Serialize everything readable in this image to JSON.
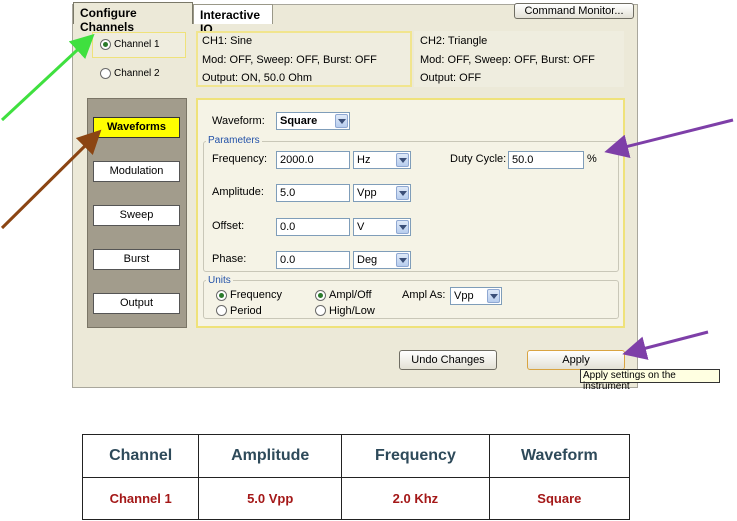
{
  "tabs": [
    "Configure Channels",
    "Interactive IO"
  ],
  "command_monitor": "Command Monitor...",
  "channels": [
    {
      "label": "Channel 1",
      "selected": true
    },
    {
      "label": "Channel 2",
      "selected": false
    }
  ],
  "ch1_info": {
    "title": "CH1:   Sine",
    "mod": "Mod: OFF, Sweep: OFF, Burst: OFF",
    "output": "Output:   ON, 50.0 Ohm"
  },
  "ch2_info": {
    "title": "CH2:   Triangle",
    "mod": "Mod: OFF, Sweep: OFF, Burst: OFF",
    "output": "Output:    OFF"
  },
  "side_menu": [
    "Waveforms",
    "Modulation",
    "Sweep",
    "Burst",
    "Output"
  ],
  "waveform": {
    "label": "Waveform:",
    "value": "Square"
  },
  "parameters": {
    "title": "Parameters",
    "frequency": {
      "label": "Frequency:",
      "value": "2000.0",
      "unit": "Hz"
    },
    "amplitude": {
      "label": "Amplitude:",
      "value": "5.0",
      "unit": "Vpp"
    },
    "offset": {
      "label": "Offset:",
      "value": "0.0",
      "unit": "V"
    },
    "phase": {
      "label": "Phase:",
      "value": "0.0",
      "unit": "Deg"
    },
    "duty_cycle": {
      "label": "Duty Cycle:",
      "value": "50.0",
      "unit": "%"
    }
  },
  "units": {
    "title": "Units",
    "frequency": "Frequency",
    "period": "Period",
    "ampl_off": "Ampl/Off",
    "high_low": "High/Low",
    "ampl_as_label": "Ampl As:",
    "ampl_as_value": "Vpp"
  },
  "undo_label": "Undo Changes",
  "apply_label": "Apply",
  "tooltip": "Apply settings on the instrument",
  "summary": {
    "headers": [
      "Channel",
      "Amplitude",
      "Frequency",
      "Waveform"
    ],
    "row": [
      "Channel 1",
      "5.0 Vpp",
      "2.0 Khz",
      "Square"
    ]
  },
  "arrow_colors": {
    "green": "#3fe03f",
    "brown": "#8b4513",
    "purple": "#7e3fa8"
  },
  "accent_yellow": "#ffff00"
}
